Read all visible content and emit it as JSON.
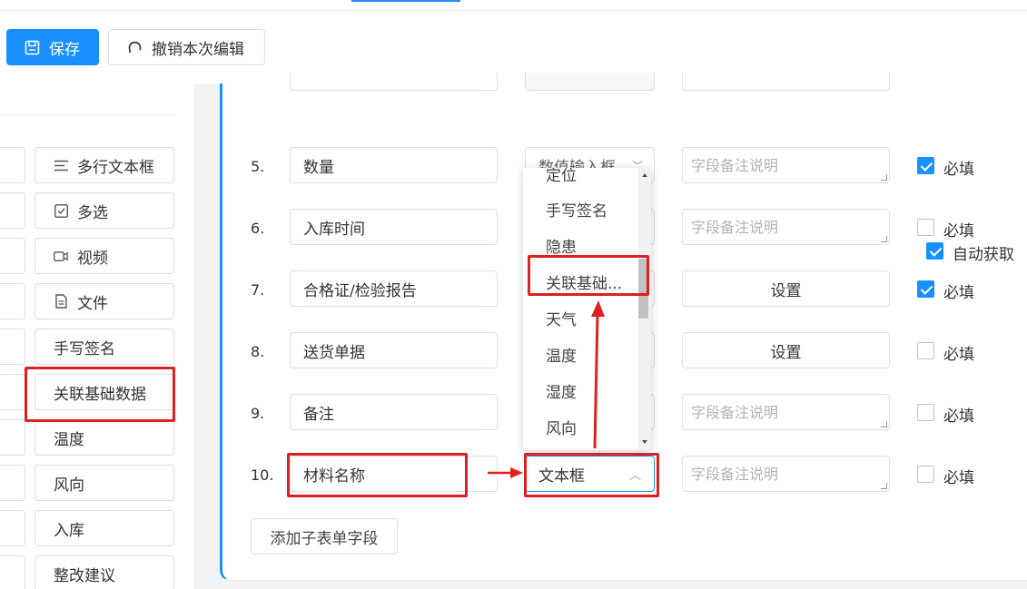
{
  "toolbar": {
    "save_label": "保存",
    "undo_label": "撤销本次编辑"
  },
  "components": [
    {
      "label": "多行文本框",
      "icon": "lines-icon"
    },
    {
      "label": "多选",
      "icon": "checkbox-icon"
    },
    {
      "label": "视频",
      "icon": "video-icon"
    },
    {
      "label": "文件",
      "icon": "file-icon"
    },
    {
      "label": "手写签名",
      "icon": ""
    },
    {
      "label": "关联基础数据",
      "icon": ""
    },
    {
      "label": "温度",
      "icon": ""
    },
    {
      "label": "风向",
      "icon": ""
    },
    {
      "label": "入库",
      "icon": ""
    },
    {
      "label": "整改建议",
      "icon": ""
    }
  ],
  "fields": [
    {
      "index": "5.",
      "name": "数量",
      "type": "数值输入框",
      "remark_placeholder": "字段备注说明",
      "required_label": "必填",
      "required": true
    },
    {
      "index": "6.",
      "name": "入库时间",
      "type": "",
      "remark_placeholder": "字段备注说明",
      "required_label": "必填",
      "required": false,
      "auto_label": "自动获取",
      "auto": true
    },
    {
      "index": "7.",
      "name": "合格证/检验报告",
      "type": "",
      "settings_label": "设置",
      "required_label": "必填",
      "required": true
    },
    {
      "index": "8.",
      "name": "送货单据",
      "type": "",
      "settings_label": "设置",
      "required_label": "必填",
      "required": false
    },
    {
      "index": "9.",
      "name": "备注",
      "type": "",
      "remark_placeholder": "字段备注说明",
      "required_label": "必填",
      "required": false
    },
    {
      "index": "10.",
      "name": "材料名称",
      "type": "文本框",
      "remark_placeholder": "字段备注说明",
      "required_label": "必填",
      "required": false
    }
  ],
  "dropdown": {
    "items": [
      "定位",
      "手写签名",
      "隐患",
      "关联基础...",
      "天气",
      "温度",
      "湿度",
      "风向"
    ],
    "highlighted": "关联基础..."
  },
  "add_field_label": "添加子表单字段",
  "colors": {
    "primary": "#1890ff",
    "annotation": "#e02020"
  }
}
